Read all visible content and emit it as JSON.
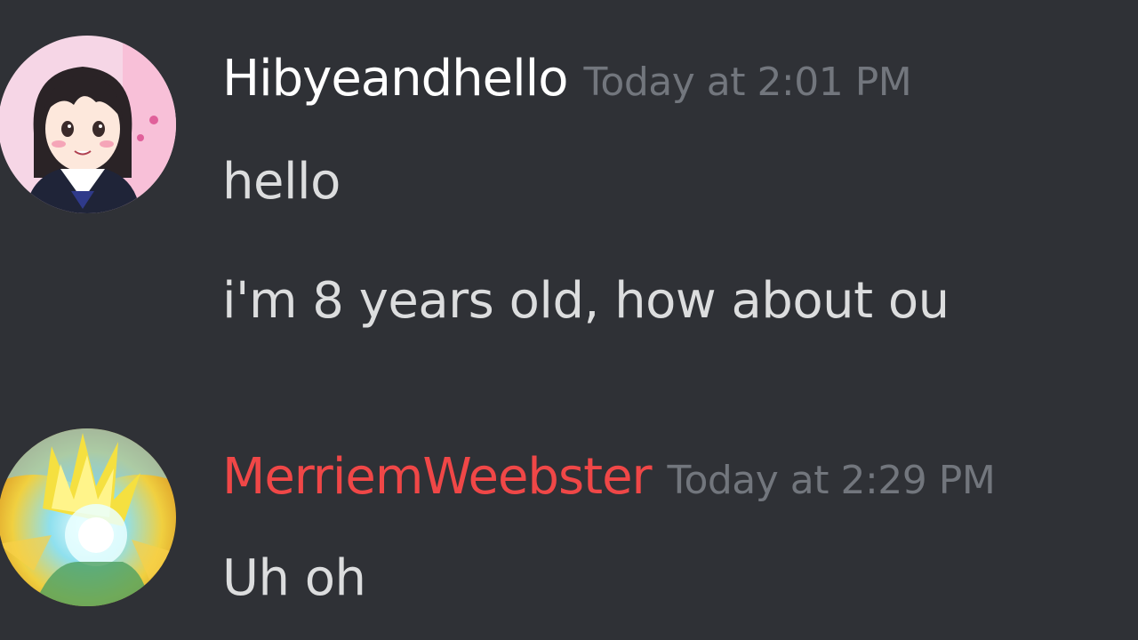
{
  "messages": [
    {
      "author": "Hibyeandhello",
      "author_color": "#ffffff",
      "timestamp": "Today at 2:01 PM",
      "avatar": "anime-girl-avatar",
      "lines": [
        "hello",
        "i'm 8 years old, how about ou"
      ]
    },
    {
      "author": "MerriemWeebster",
      "author_color": "#f04747",
      "timestamp": "Today at 2:29 PM",
      "avatar": "super-saiyan-avatar",
      "lines": [
        "Uh oh"
      ]
    }
  ],
  "colors": {
    "background": "#2f3136",
    "message_text": "#dcddde",
    "timestamp": "#72767d"
  }
}
